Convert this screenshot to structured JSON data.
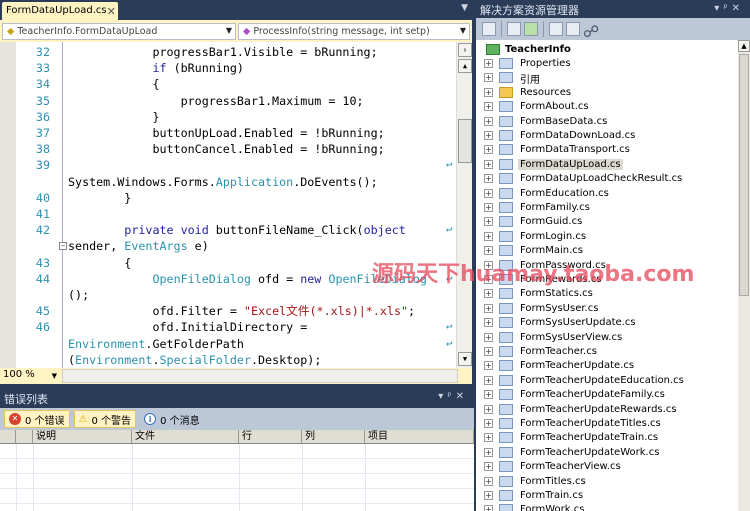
{
  "tab": {
    "label": "FormDataUpLoad.cs",
    "close": "✕"
  },
  "nav": {
    "class_combo": "TeacherInfo.FormDataUpLoad",
    "member_combo": "ProcessInfo(string message, int setp)"
  },
  "code_rows": [
    {
      "ln": "32",
      "segs": [
        [
          "            progressBar1.Visible = bRunning;",
          ""
        ]
      ]
    },
    {
      "ln": "33",
      "segs": [
        [
          "            ",
          ""
        ],
        [
          "if",
          "k"
        ],
        [
          " (bRunning)",
          ""
        ]
      ]
    },
    {
      "ln": "34",
      "segs": [
        [
          "            {",
          ""
        ]
      ]
    },
    {
      "ln": "35",
      "segs": [
        [
          "                progressBar1.Maximum = 10;",
          ""
        ]
      ]
    },
    {
      "ln": "36",
      "segs": [
        [
          "            }",
          ""
        ]
      ]
    },
    {
      "ln": "37",
      "segs": [
        [
          "            buttonUpLoad.Enabled = !bRunning;",
          ""
        ]
      ]
    },
    {
      "ln": "38",
      "segs": [
        [
          "            buttonCancel.Enabled = !bRunning;",
          ""
        ]
      ]
    },
    {
      "ln": "39",
      "segs": [],
      "wrap": true
    },
    {
      "ln": "",
      "segs": [
        [
          "System.Windows.Forms.",
          ""
        ],
        [
          "Application",
          "t"
        ],
        [
          ".DoEvents();",
          ""
        ]
      ]
    },
    {
      "ln": "40",
      "segs": [
        [
          "        }",
          ""
        ]
      ]
    },
    {
      "ln": "41",
      "segs": []
    },
    {
      "ln": "42",
      "segs": [
        [
          "        ",
          ""
        ],
        [
          "private",
          "k"
        ],
        [
          " ",
          ""
        ],
        [
          "void",
          "k"
        ],
        [
          " buttonFileName_Click(",
          ""
        ],
        [
          "object",
          "k"
        ]
      ],
      "wrap": true
    },
    {
      "ln": "",
      "segs": [
        [
          "sender, ",
          ""
        ],
        [
          "EventArgs",
          "t"
        ],
        [
          " e)",
          ""
        ]
      ],
      "fold": true
    },
    {
      "ln": "43",
      "segs": [
        [
          "        {",
          ""
        ]
      ]
    },
    {
      "ln": "44",
      "segs": [
        [
          "            ",
          ""
        ],
        [
          "OpenFileDialog",
          "t"
        ],
        [
          " ofd = ",
          ""
        ],
        [
          "new",
          "k"
        ],
        [
          " ",
          ""
        ],
        [
          "OpenFileDialog",
          "t"
        ]
      ],
      "wrap": true
    },
    {
      "ln": "",
      "segs": [
        [
          "();",
          ""
        ]
      ]
    },
    {
      "ln": "45",
      "segs": [
        [
          "            ofd.Filter = ",
          ""
        ],
        [
          "\"Excel文件(*.xls)|*.xls\"",
          "s"
        ],
        [
          ";",
          ""
        ]
      ]
    },
    {
      "ln": "46",
      "segs": [
        [
          "            ofd.InitialDirectory =",
          ""
        ]
      ],
      "wrap": true
    },
    {
      "ln": "",
      "segs": [
        [
          "Environment",
          "t"
        ],
        [
          ".GetFolderPath",
          ""
        ]
      ],
      "wrap": true
    },
    {
      "ln": "",
      "segs": [
        [
          "(",
          ""
        ],
        [
          "Environment",
          "t"
        ],
        [
          ".",
          ""
        ],
        [
          "SpecialFolder",
          "t"
        ],
        [
          ".Desktop);",
          ""
        ]
      ]
    }
  ],
  "zoom_level": "100 %",
  "error_list": {
    "title": "错误列表",
    "errors": "0 个错误",
    "warnings": "0 个警告",
    "messages": "0 个消息",
    "columns": [
      "",
      "",
      "说明",
      "文件",
      "行",
      "列",
      "项目"
    ]
  },
  "solution_explorer": {
    "title": "解决方案资源管理器",
    "project": "TeacherInfo",
    "items": [
      {
        "label": "Properties",
        "icon": "properties-icon"
      },
      {
        "label": "引用",
        "icon": "references-icon"
      },
      {
        "label": "Resources",
        "icon": "folder-icon"
      },
      {
        "label": "FormAbout.cs",
        "icon": "form-icon"
      },
      {
        "label": "FormBaseData.cs",
        "icon": "form-icon"
      },
      {
        "label": "FormDataDownLoad.cs",
        "icon": "form-icon"
      },
      {
        "label": "FormDataTransport.cs",
        "icon": "form-icon"
      },
      {
        "label": "FormDataUpLoad.cs",
        "icon": "form-icon",
        "selected": true
      },
      {
        "label": "FormDataUpLoadCheckResult.cs",
        "icon": "form-icon"
      },
      {
        "label": "FormEducation.cs",
        "icon": "form-icon"
      },
      {
        "label": "FormFamily.cs",
        "icon": "form-icon"
      },
      {
        "label": "FormGuid.cs",
        "icon": "form-icon"
      },
      {
        "label": "FormLogin.cs",
        "icon": "form-icon"
      },
      {
        "label": "FormMain.cs",
        "icon": "form-icon"
      },
      {
        "label": "FormPassword.cs",
        "icon": "form-icon"
      },
      {
        "label": "FormRewards.cs",
        "icon": "form-icon"
      },
      {
        "label": "FormStatics.cs",
        "icon": "form-icon"
      },
      {
        "label": "FormSysUser.cs",
        "icon": "form-icon"
      },
      {
        "label": "FormSysUserUpdate.cs",
        "icon": "form-icon"
      },
      {
        "label": "FormSysUserView.cs",
        "icon": "form-icon"
      },
      {
        "label": "FormTeacher.cs",
        "icon": "form-icon"
      },
      {
        "label": "FormTeacherUpdate.cs",
        "icon": "form-icon"
      },
      {
        "label": "FormTeacherUpdateEducation.cs",
        "icon": "form-icon"
      },
      {
        "label": "FormTeacherUpdateFamily.cs",
        "icon": "form-icon"
      },
      {
        "label": "FormTeacherUpdateRewards.cs",
        "icon": "form-icon"
      },
      {
        "label": "FormTeacherUpdateTitles.cs",
        "icon": "form-icon"
      },
      {
        "label": "FormTeacherUpdateTrain.cs",
        "icon": "form-icon"
      },
      {
        "label": "FormTeacherUpdateWork.cs",
        "icon": "form-icon"
      },
      {
        "label": "FormTeacherView.cs",
        "icon": "form-icon"
      },
      {
        "label": "FormTitles.cs",
        "icon": "form-icon"
      },
      {
        "label": "FormTrain.cs",
        "icon": "form-icon"
      },
      {
        "label": "FormWork.cs",
        "icon": "form-icon"
      }
    ]
  },
  "watermark": "源码天下huamay.taoba.com",
  "colors": {
    "chrome": "#2b3c59",
    "tab_active": "#fff3c4",
    "keyword": "#1f1fa0",
    "type": "#2b91af",
    "string": "#a31515"
  }
}
